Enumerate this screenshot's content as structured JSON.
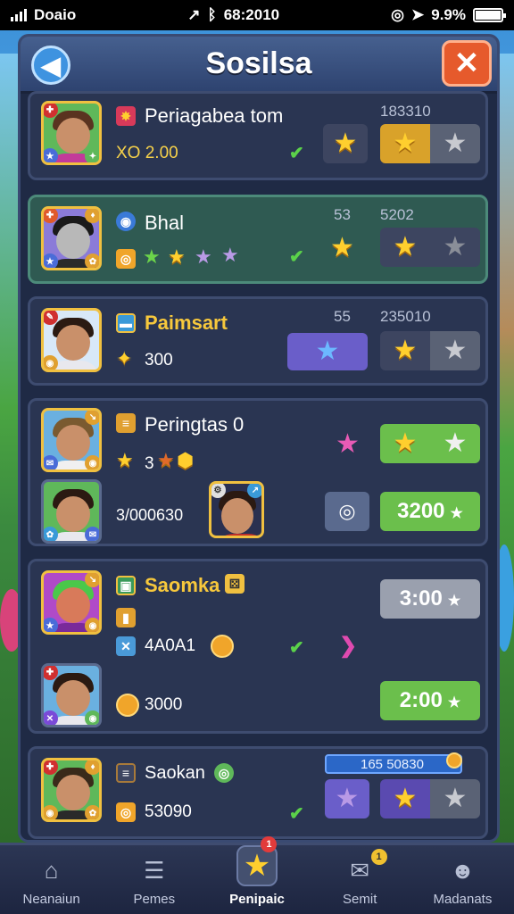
{
  "status_bar": {
    "carrier": "Doaio",
    "time": "68:2010",
    "battery": "9.9%"
  },
  "header": {
    "title": "Sosilsa"
  },
  "items": [
    {
      "name": "Periagabea tom",
      "sub": "XO 2.00",
      "count": "183310"
    },
    {
      "name": "Bhal",
      "count_a": "53",
      "count_b": "5202"
    },
    {
      "name": "Paimsart",
      "sub": "300",
      "count_a": "55",
      "count_b": "235010"
    },
    {
      "name": "Peringtas 0",
      "sub_star": "3",
      "code": "3/000630",
      "price": "3200"
    },
    {
      "name": "Saomka",
      "sub": "4A0A1",
      "coins": "3000",
      "price_a": "3:00",
      "price_b": "2:00"
    },
    {
      "name": "Saokan",
      "sub": "53090",
      "progress": "165 50830"
    }
  ],
  "bottom_nav": [
    {
      "label": "Neanaiun",
      "icon": "home-icon"
    },
    {
      "label": "Pemes",
      "icon": "users-icon"
    },
    {
      "label": "Penipaic",
      "icon": "star-icon",
      "badge": "1"
    },
    {
      "label": "Semit",
      "icon": "mail-icon",
      "badge": "1"
    },
    {
      "label": "Madanats",
      "icon": "profile-icon"
    }
  ],
  "colors": {
    "accent": "#f7c83c",
    "panel": "#1f2a45",
    "green_button": "#6bbf4c"
  }
}
